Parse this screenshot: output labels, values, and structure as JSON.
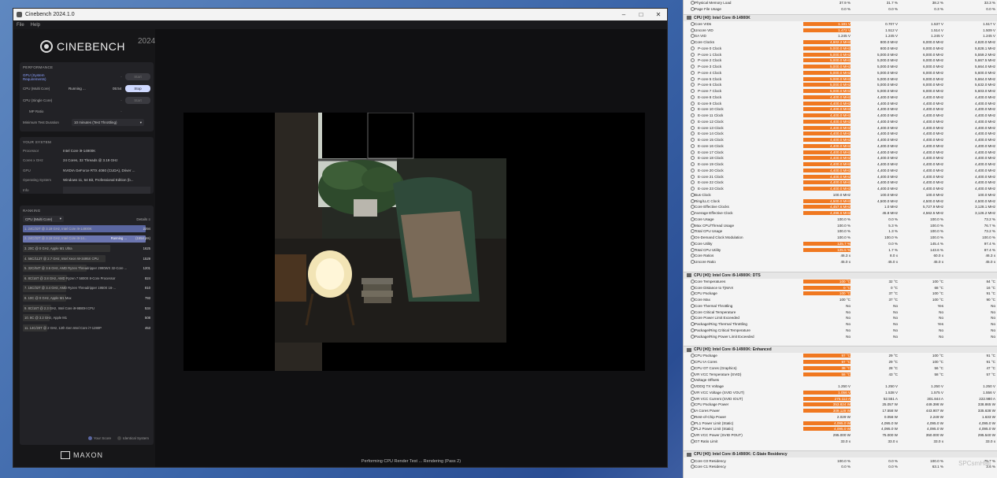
{
  "cinebench": {
    "window_title": "Cinebench 2024.1.0",
    "menu": [
      "File",
      "Help"
    ],
    "logo_text": "CINEBENCH",
    "logo_year": "2024",
    "performance": {
      "heading": "PERFORMANCE",
      "gpu_label": "GPU (System Requirements)",
      "gpu_dash": "-",
      "gpu_button": "Start",
      "cpu_multi_label": "CPU (Multi Core)",
      "cpu_multi_status": "Running ...",
      "cpu_multi_time": "05:54",
      "stop_button": "Stop",
      "cpu_single_label": "CPU (Single Core)",
      "cpu_single_dash": "-",
      "cpu_single_button": "Start",
      "mp_ratio_label": "MP Ratio",
      "mp_ratio_value": "-",
      "min_duration_label": "Minimum Test Duration",
      "min_duration_value": "10 minutes (Test Throttling)"
    },
    "system": {
      "heading": "YOUR SYSTEM",
      "rows": [
        {
          "k": "Processor",
          "v": "Intel Core i9-14900K"
        },
        {
          "k": "Cores x GHz",
          "v": "24 Cores, 32 Threads @ 3.19 GHz"
        },
        {
          "k": "GPU",
          "v": "NVIDIA GeForce RTX 4080 (CUDA), Driver ..."
        },
        {
          "k": "Operating System",
          "v": "Windows 11, 64 Bit, Professional Edition (b..."
        }
      ],
      "info_label": "Info"
    },
    "ranking": {
      "heading": "RANKING",
      "select": "CPU (Multi Core)",
      "details": "Details",
      "rows": [
        {
          "name": "1. 24C/32T @ 3.19 GHz, Intel Core i9-14900K",
          "score": "2294",
          "pct": 100,
          "type": "me"
        },
        {
          "name": "2. 24C/32T @ 3.19 GHz, Intel Core i9-14...",
          "running": "Running ...",
          "score": "(1554 pts)",
          "pct": 100,
          "type": "cur"
        },
        {
          "name": "3. 20C @ 0 GHz, Apple M1 Ultra",
          "score": "1625",
          "pct": 71,
          "type": ""
        },
        {
          "name": "4. 56C/112T @ 2.7 GHz, Intel Xeon W-3495X CPU",
          "score": "1529",
          "pct": 67,
          "type": ""
        },
        {
          "name": "5. 32C/64T @ 3.6 GHz, AMD Ryzen Threadripper 2990WX 32-Core ...",
          "score": "1201",
          "pct": 52,
          "type": ""
        },
        {
          "name": "6. 8C/16T @ 3.8 GHz, AMD Ryzen 7 5800X 8-Core Processor",
          "score": "824",
          "pct": 36,
          "type": ""
        },
        {
          "name": "7. 16C/32T @ 3.4 GHz, AMD Ryzen Threadripper 1950X 16-...",
          "score": "810",
          "pct": 35,
          "type": ""
        },
        {
          "name": "8. 10C @ 0 GHz, Apple M1 Max",
          "score": "793",
          "pct": 35,
          "type": ""
        },
        {
          "name": "9. 8C/16T @ 2.3 GHz, Intel Core i9-9880H CPU",
          "score": "534",
          "pct": 23,
          "type": ""
        },
        {
          "name": "10. 8C @ 3.2 GHz, Apple M1",
          "score": "508",
          "pct": 22,
          "type": ""
        },
        {
          "name": "11. 14C/20T @ 2 GHz, 12th Gen Intel Core i7-1280P",
          "score": "453",
          "pct": 20,
          "type": ""
        }
      ],
      "legend_your": "Your Score",
      "legend_identical": "Identical System"
    },
    "maxon": "MAXON",
    "status": "Performing CPU Render Test ... Rendering (Pass 2)"
  },
  "hwinfo": {
    "top_rows": [
      {
        "n": "Physical Memory Load",
        "c1": "37.9 %",
        "c2": "31.7 %",
        "c3": "38.2 %",
        "c4": "33.3 %"
      },
      {
        "n": "Page File Usage",
        "c1": "0.0 %",
        "c2": "0.0 %",
        "c3": "0.3 %",
        "c4": "0.0 %"
      }
    ],
    "sections": [
      {
        "title": "CPU [#0]: Intel Core i9-14900K",
        "rows": [
          {
            "n": "Core VIDs",
            "c1": "1.181 V",
            "c2": "0.707 V",
            "c3": "1.537 V",
            "c4": "1.517 V",
            "hl": true
          },
          {
            "n": "Uncore VID",
            "c1": "1.472 V",
            "c2": "1.512 V",
            "c3": "1.514 V",
            "c4": "1.509 V",
            "hl": true
          },
          {
            "n": "SA VID",
            "c1": "1.245 V",
            "c2": "1.245 V",
            "c3": "1.245 V",
            "c4": "1.245 V"
          },
          {
            "n": "Core Clocks",
            "c1": "4,602.2 MHz",
            "c2": "800.0 MHz",
            "c3": "6,000.0 MHz",
            "c4": "4,820.0 MHz",
            "hl": true
          },
          {
            "n": "P-core 0 Clock",
            "c1": "5,000.0 MHz",
            "c2": "800.0 MHz",
            "c3": "6,000.0 MHz",
            "c4": "5,828.1 MHz",
            "hl": true,
            "ind": true
          },
          {
            "n": "P-core 1 Clock",
            "c1": "5,000.0 MHz",
            "c2": "5,000.0 MHz",
            "c3": "6,000.0 MHz",
            "c4": "5,559.2 MHz",
            "hl": true,
            "ind": true
          },
          {
            "n": "P-core 2 Clock",
            "c1": "5,000.0 MHz",
            "c2": "5,000.0 MHz",
            "c3": "6,000.0 MHz",
            "c4": "5,667.5 MHz",
            "hl": true,
            "ind": true
          },
          {
            "n": "P-core 3 Clock",
            "c1": "5,000.0 MHz",
            "c2": "5,000.0 MHz",
            "c3": "6,000.0 MHz",
            "c4": "5,664.0 MHz",
            "hl": true,
            "ind": true
          },
          {
            "n": "P-core 4 Clock",
            "c1": "5,000.0 MHz",
            "c2": "5,000.0 MHz",
            "c3": "6,000.0 MHz",
            "c4": "5,600.0 MHz",
            "hl": true,
            "ind": true
          },
          {
            "n": "P-core 5 Clock",
            "c1": "5,000.0 MHz",
            "c2": "5,000.0 MHz",
            "c3": "6,000.0 MHz",
            "c4": "5,664.0 MHz",
            "hl": true,
            "ind": true
          },
          {
            "n": "P-core 6 Clock",
            "c1": "5,000.0 MHz",
            "c2": "5,000.0 MHz",
            "c3": "6,000.0 MHz",
            "c4": "5,632.0 MHz",
            "hl": true,
            "ind": true
          },
          {
            "n": "P-core 7 Clock",
            "c1": "5,000.0 MHz",
            "c2": "5,000.0 MHz",
            "c3": "6,000.0 MHz",
            "c4": "5,603.0 MHz",
            "hl": true,
            "ind": true
          },
          {
            "n": "E-core 8 Clock",
            "c1": "4,400.0 MHz",
            "c2": "4,400.0 MHz",
            "c3": "4,400.0 MHz",
            "c4": "4,400.0 MHz",
            "hl": true,
            "ind": true
          },
          {
            "n": "E-core 9 Clock",
            "c1": "4,400.0 MHz",
            "c2": "4,400.0 MHz",
            "c3": "4,400.0 MHz",
            "c4": "4,400.0 MHz",
            "hl": true,
            "ind": true
          },
          {
            "n": "E-core 10 Clock",
            "c1": "4,400.0 MHz",
            "c2": "4,400.0 MHz",
            "c3": "4,400.0 MHz",
            "c4": "4,400.0 MHz",
            "hl": true,
            "ind": true
          },
          {
            "n": "E-core 11 Clock",
            "c1": "4,400.0 MHz",
            "c2": "4,400.0 MHz",
            "c3": "4,400.0 MHz",
            "c4": "4,400.0 MHz",
            "hl": true,
            "ind": true
          },
          {
            "n": "E-core 12 Clock",
            "c1": "4,400.0 MHz",
            "c2": "4,400.0 MHz",
            "c3": "4,400.0 MHz",
            "c4": "4,400.0 MHz",
            "hl": true,
            "ind": true
          },
          {
            "n": "E-core 13 Clock",
            "c1": "4,400.0 MHz",
            "c2": "4,400.0 MHz",
            "c3": "4,400.0 MHz",
            "c4": "4,400.0 MHz",
            "hl": true,
            "ind": true
          },
          {
            "n": "E-core 14 Clock",
            "c1": "4,400.0 MHz",
            "c2": "4,400.0 MHz",
            "c3": "4,400.0 MHz",
            "c4": "4,400.0 MHz",
            "hl": true,
            "ind": true
          },
          {
            "n": "E-core 15 Clock",
            "c1": "4,400.0 MHz",
            "c2": "4,400.0 MHz",
            "c3": "4,400.0 MHz",
            "c4": "4,400.0 MHz",
            "hl": true,
            "ind": true
          },
          {
            "n": "E-core 16 Clock",
            "c1": "4,400.0 MHz",
            "c2": "4,400.0 MHz",
            "c3": "4,400.0 MHz",
            "c4": "4,400.0 MHz",
            "hl": true,
            "ind": true
          },
          {
            "n": "E-core 17 Clock",
            "c1": "4,400.0 MHz",
            "c2": "4,400.0 MHz",
            "c3": "4,400.0 MHz",
            "c4": "4,400.0 MHz",
            "hl": true,
            "ind": true
          },
          {
            "n": "E-core 18 Clock",
            "c1": "4,400.0 MHz",
            "c2": "4,400.0 MHz",
            "c3": "4,400.0 MHz",
            "c4": "4,400.0 MHz",
            "hl": true,
            "ind": true
          },
          {
            "n": "E-core 19 Clock",
            "c1": "4,400.0 MHz",
            "c2": "4,400.0 MHz",
            "c3": "4,400.0 MHz",
            "c4": "4,400.0 MHz",
            "hl": true,
            "ind": true
          },
          {
            "n": "E-core 20 Clock",
            "c1": "4,400.0 MHz",
            "c2": "4,400.0 MHz",
            "c3": "4,400.0 MHz",
            "c4": "4,400.0 MHz",
            "hl": true,
            "ind": true
          },
          {
            "n": "E-core 21 Clock",
            "c1": "4,400.0 MHz",
            "c2": "4,400.0 MHz",
            "c3": "4,400.0 MHz",
            "c4": "4,400.0 MHz",
            "hl": true,
            "ind": true
          },
          {
            "n": "E-core 22 Clock",
            "c1": "4,400.0 MHz",
            "c2": "4,400.0 MHz",
            "c3": "4,400.0 MHz",
            "c4": "4,400.0 MHz",
            "hl": true,
            "ind": true
          },
          {
            "n": "E-core 23 Clock",
            "c1": "4,400.0 MHz",
            "c2": "4,400.0 MHz",
            "c3": "4,400.0 MHz",
            "c4": "4,400.0 MHz",
            "hl": true,
            "ind": true
          },
          {
            "n": "Bus Clock",
            "c1": "100.0 MHz",
            "c2": "100.0 MHz",
            "c3": "100.0 MHz",
            "c4": "100.0 MHz"
          },
          {
            "n": "Ring/LLC Clock",
            "c1": "4,500.0 MHz",
            "c2": "4,500.0 MHz",
            "c3": "4,500.0 MHz",
            "c4": "4,500.0 MHz",
            "hl": true
          },
          {
            "n": "Core Effective Clocks",
            "c1": "4,457.6 MHz",
            "c2": "1.0 MHz",
            "c3": "5,727.9 MHz",
            "c4": "3,128.1 MHz",
            "hl": true
          },
          {
            "n": "Average Effective Clock",
            "c1": "4,496.6 MHz",
            "c2": "45.8 MHz",
            "c3": "4,562.5 MHz",
            "c4": "3,126.2 MHz",
            "hl": true
          },
          {
            "n": "Core Usage",
            "c1": "100.0 %",
            "c2": "0.0 %",
            "c3": "100.0 %",
            "c4": "73.2 %"
          },
          {
            "n": "Max CPU/Thread Usage",
            "c1": "100.0 %",
            "c2": "5.3 %",
            "c3": "100.0 %",
            "c4": "76.7 %"
          },
          {
            "n": "Total CPU Usage",
            "c1": "100.0 %",
            "c2": "1.3 %",
            "c3": "100.0 %",
            "c4": "73.2 %"
          },
          {
            "n": "On-Demand Clock Modulation",
            "c1": "100.0 %",
            "c2": "100.0 %",
            "c3": "100.0 %",
            "c4": "100.0 %"
          },
          {
            "n": "Core Utility",
            "c1": "125.7 %",
            "c2": "0.0 %",
            "c3": "145.4 %",
            "c4": "97.4 %",
            "hl": true
          },
          {
            "n": "Total CPU Utility",
            "c1": "125.5 %",
            "c2": "1.7 %",
            "c3": "143.6 %",
            "c4": "87.4 %",
            "hl": true
          },
          {
            "n": "Core Ratios",
            "c1": "46.3 x",
            "c2": "8.0 x",
            "c3": "60.0 x",
            "c4": "46.3 x"
          },
          {
            "n": "Uncore Ratio",
            "c1": "45.0 x",
            "c2": "45.0 x",
            "c3": "45.0 x",
            "c4": "45.0 x"
          }
        ]
      },
      {
        "title": "CPU [#0]: Intel Core i9-14900K: DTS",
        "rows": [
          {
            "n": "Core Temperatures",
            "c1": "100 °C",
            "c2": "32 °C",
            "c3": "100 °C",
            "c4": "84 °C",
            "hl": true
          },
          {
            "n": "Core Distance to TjMAX",
            "c1": "0 °C",
            "c2": "0 °C",
            "c3": "68 °C",
            "c4": "16 °C",
            "hl": true
          },
          {
            "n": "CPU Package",
            "c1": "100 °C",
            "c2": "37 °C",
            "c3": "100 °C",
            "c4": "91 °C",
            "hl": true
          },
          {
            "n": "Core Max",
            "c1": "100 °C",
            "c2": "37 °C",
            "c3": "100 °C",
            "c4": "90 °C"
          },
          {
            "n": "Core Thermal Throttling",
            "c1": "No",
            "c2": "No",
            "c3": "Yes",
            "c4": "No"
          },
          {
            "n": "Core Critical Temperature",
            "c1": "No",
            "c2": "No",
            "c3": "No",
            "c4": "No"
          },
          {
            "n": "Core Power Limit Exceeded",
            "c1": "No",
            "c2": "No",
            "c3": "No",
            "c4": "No"
          },
          {
            "n": "Package/Ring Thermal Throttling",
            "c1": "No",
            "c2": "No",
            "c3": "Yes",
            "c4": "No"
          },
          {
            "n": "Package/Ring Critical Temperature",
            "c1": "No",
            "c2": "No",
            "c3": "No",
            "c4": "No"
          },
          {
            "n": "Package/Ring Power Limit Exceeded",
            "c1": "No",
            "c2": "No",
            "c3": "No",
            "c4": "No"
          }
        ]
      },
      {
        "title": "CPU [#0]: Intel Core i9-14900K: Enhanced",
        "rows": [
          {
            "n": "CPU Package",
            "c1": "97 °C",
            "c2": "29 °C",
            "c3": "100 °C",
            "c4": "91 °C",
            "hl": true
          },
          {
            "n": "CPU IA Cores",
            "c1": "97 °C",
            "c2": "29 °C",
            "c3": "100 °C",
            "c4": "91 °C",
            "hl": true
          },
          {
            "n": "CPU GT Cores (Graphics)",
            "c1": "38 °C",
            "c2": "28 °C",
            "c3": "56 °C",
            "c4": "47 °C",
            "hl": true
          },
          {
            "n": "VR VCC Temperature (SVID)",
            "c1": "58 °C",
            "c2": "43 °C",
            "c3": "58 °C",
            "c4": "57 °C",
            "hl": true
          },
          {
            "n": "Voltage Offsets",
            "c1": "",
            "c2": "",
            "c3": "",
            "c4": ""
          },
          {
            "n": "VDDQ TX Voltage",
            "c1": "1.250 V",
            "c2": "1.250 V",
            "c3": "1.250 V",
            "c4": "1.250 V"
          },
          {
            "n": "VR VCC Voltage (SVID VOUT)",
            "c1": "1.056 V",
            "c2": "1.538 V",
            "c3": "1.575 V",
            "c4": "1.556 V",
            "hl": true
          },
          {
            "n": "VR VCC Current (SVID IOUT)",
            "c1": "275.112 A",
            "c2": "52.551 A",
            "c3": "301.844 A",
            "c4": "222.980 A",
            "hl": true
          },
          {
            "n": "CPU Package Power",
            "c1": "353.824 W",
            "c2": "25.057 W",
            "c3": "449.398 W",
            "c4": "338.865 W",
            "hl": true
          },
          {
            "n": "IA Cores Power",
            "c1": "309.128 W",
            "c2": "17.558 W",
            "c3": "443.907 W",
            "c4": "335.638 W",
            "hl": true
          },
          {
            "n": "Rest-of-Chip Power",
            "c1": "2.029 W",
            "c2": "0.056 W",
            "c3": "2.249 W",
            "c4": "1.633 W"
          },
          {
            "n": "PL1 Power Limit (Static)",
            "c1": "4,095.0 W",
            "c2": "4,095.0 W",
            "c3": "4,095.0 W",
            "c4": "4,095.0 W",
            "hl": true
          },
          {
            "n": "PL2 Power Limit (Static)",
            "c1": "4,095.0 W",
            "c2": "4,095.0 W",
            "c3": "4,095.0 W",
            "c4": "4,095.0 W",
            "hl": true
          },
          {
            "n": "VR VCC Power (SVID POUT)",
            "c1": "295.000 W",
            "c2": "75.000 W",
            "c3": "350.000 W",
            "c4": "295.540 W"
          },
          {
            "n": "GT Ratio Limit",
            "c1": "33.0 x",
            "c2": "33.0 x",
            "c3": "33.0 x",
            "c4": "33.0 x"
          }
        ]
      },
      {
        "title": "CPU [#0]: Intel Core i9-14900K: C-State Residency",
        "rows": [
          {
            "n": "Core C0 Residency",
            "c1": "100.0 %",
            "c2": "0.0 %",
            "c3": "100.0 %",
            "c4": "75.7 %"
          },
          {
            "n": "Core C1 Residency",
            "c1": "0.0 %",
            "c2": "0.0 %",
            "c3": "63.1 %",
            "c4": "3.6 %"
          }
        ]
      }
    ],
    "watermark": "SPCsmHall"
  },
  "colors": {
    "highlight": "#f07820",
    "accent": "#cfd9ff"
  }
}
